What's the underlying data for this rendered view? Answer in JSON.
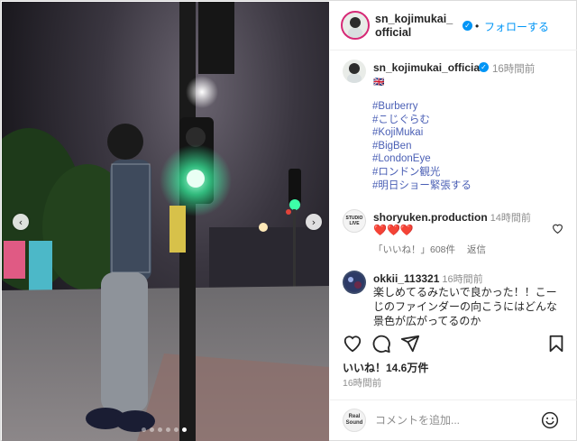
{
  "header": {
    "username": "sn_kojimukai_official",
    "follow_label": "フォローする",
    "separator": "•"
  },
  "caption": {
    "username": "sn_kojimukai_official",
    "time": "16時間前",
    "flag": "🇬🇧",
    "hashtags": [
      "#Burberry",
      "#こじぐらむ",
      "#KojiMukai",
      "#BigBen",
      "#LondonEye",
      "#ロンドン観光",
      "#明日ショー緊張する"
    ]
  },
  "comments": [
    {
      "username": "shoryuken.production",
      "time": "14時間前",
      "text": "❤️❤️❤️",
      "likes_label": "「いいね！」608件",
      "reply_label": "返信",
      "avatar_text": "STUDIO LIVE"
    },
    {
      "username": "okkii_113321",
      "time": "16時間前",
      "text": "楽しめてるみたいで良かった！！こーじのファインダーの向こうにはどんな景色が広がってるのか"
    }
  ],
  "stats": {
    "likes": "いいね！14.6万件",
    "date": "16時間前"
  },
  "comment_box": {
    "placeholder": "コメントを追加...",
    "avatar_text": "Real Sound"
  },
  "icons": {
    "like": "heart-icon",
    "comment": "comment-icon",
    "share": "paper-plane-icon",
    "save": "bookmark-icon",
    "emoji": "smiley-icon",
    "prev": "chevron-left-icon",
    "next": "chevron-right-icon"
  },
  "colors": {
    "link": "#0095f6",
    "hashtag": "#4a5fb5",
    "muted": "#8e8e8e",
    "verified": "#0095f6",
    "traffic_light_green": "#3dffa8"
  },
  "carousel": {
    "total_slides": 6,
    "current_slide": 6
  }
}
